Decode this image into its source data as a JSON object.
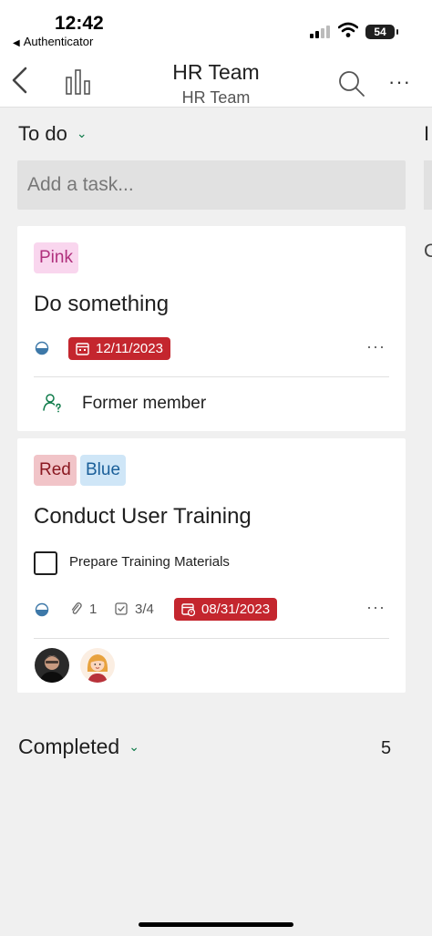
{
  "status_bar": {
    "time": "12:42",
    "back_app": "Authenticator",
    "battery": "54"
  },
  "nav": {
    "title": "HR Team",
    "subtitle": "HR Team",
    "back_icon": "chevron-left-icon",
    "chart_icon": "bar-chart-icon",
    "search_icon": "search-icon",
    "more_icon": "more-icon",
    "more_glyph": "···"
  },
  "column": {
    "title": "To do",
    "add_task_placeholder": "Add a task..."
  },
  "next_column": {
    "title_peek": "I",
    "text_peek": "C"
  },
  "tasks": [
    {
      "labels": [
        "Pink"
      ],
      "title": "Do something",
      "due_date": "12/11/2023",
      "assignee": "Former member",
      "more": "···"
    },
    {
      "labels": [
        "Red",
        "Blue"
      ],
      "title": "Conduct User Training",
      "checklist_item": "Prepare Training Materials",
      "attachments": "1",
      "checklist_progress": "3/4",
      "due_date": "08/31/2023",
      "more": "···"
    }
  ],
  "completed": {
    "label": "Completed",
    "count": "5"
  },
  "colors": {
    "accent_green": "#0f7b4a",
    "due_red": "#c4262e",
    "tag_pink_bg": "#f9d6ee",
    "tag_red_bg": "#f1c4c8",
    "tag_blue_bg": "#cfe6f7"
  }
}
